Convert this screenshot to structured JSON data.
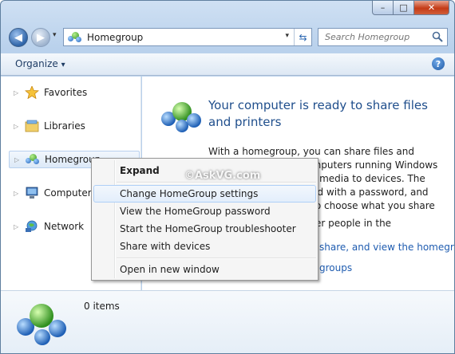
{
  "window": {
    "caption": {
      "minimize_glyph": "–",
      "maximize_glyph": "□",
      "close_glyph": "✕"
    }
  },
  "navigation": {
    "back_glyph": "◀",
    "forward_glyph": "▶",
    "recent_glyph": "▾",
    "address": {
      "text": "Homegroup",
      "icon": "homegroup-icon",
      "dropdown_glyph": "▾",
      "refresh_glyph": "⇆"
    },
    "search": {
      "placeholder": "Search Homegroup",
      "icon": "search-icon"
    }
  },
  "toolbar": {
    "organize_label": "Organize",
    "organize_arrow": "▾",
    "help_glyph": "?"
  },
  "nav_pane": {
    "items": [
      {
        "label": "Favorites",
        "icon": "star-icon"
      },
      {
        "label": "Libraries",
        "icon": "libraries-icon"
      },
      {
        "label": "Homegroup",
        "icon": "homegroup-icon"
      },
      {
        "label": "Computer",
        "icon": "computer-icon"
      },
      {
        "label": "Network",
        "icon": "network-icon"
      }
    ],
    "expand_glyph": "▷"
  },
  "content": {
    "title": "Your computer is ready to share files and printers",
    "body": "With a homegroup, you can share files and printers with other computers running Windows 7. You can also stream media to devices. The homegroup is protected with a password, and you'll always be able to choose what you share with the group.",
    "line_partial": "Tell me more about homegroups",
    "frag_people": "er people in the",
    "link_share": "share, and view the homegr",
    "link_homegroups": "groups"
  },
  "context_menu": {
    "items": [
      {
        "label": "Expand",
        "bold": true
      },
      {
        "label": "Change HomeGroup settings",
        "hover": true
      },
      {
        "label": "View the HomeGroup password"
      },
      {
        "label": "Start the HomeGroup troubleshooter"
      },
      {
        "label": "Share with devices"
      },
      {
        "label": "Open in new window"
      }
    ]
  },
  "details": {
    "items_count": "0 items"
  },
  "watermark": "©AskVG.com",
  "colors": {
    "accent": "#1f4e8c",
    "link": "#1f5cb0",
    "close_red": "#c43a16"
  }
}
